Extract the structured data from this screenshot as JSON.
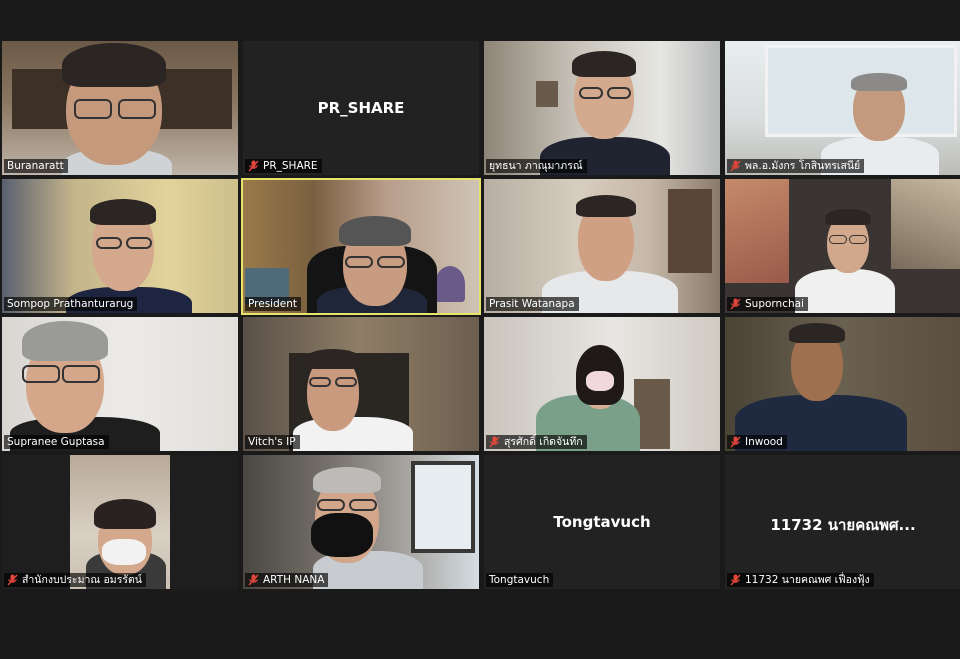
{
  "participants": [
    {
      "name": "Buranaratt",
      "muted": false
    },
    {
      "name": "PR_SHARE",
      "muted": true,
      "video_off": true,
      "display_name": "PR_SHARE"
    },
    {
      "name": "ยุทธนา ภาณุมาภรณ์",
      "muted": false
    },
    {
      "name": "พล.อ.มังกร โกสินทรเสนีย์",
      "muted": true
    },
    {
      "name": "Sompop Prathanturarug",
      "muted": false
    },
    {
      "name": "President",
      "muted": false,
      "active_speaker": true
    },
    {
      "name": "Prasit Watanapa",
      "muted": false
    },
    {
      "name": "Supornchai",
      "muted": true
    },
    {
      "name": "Supranee Guptasa",
      "muted": false
    },
    {
      "name": "Vitch's IP",
      "muted": false
    },
    {
      "name": "สุรศักดิ์ เกิดจันทึก",
      "muted": true
    },
    {
      "name": "Inwood",
      "muted": true
    },
    {
      "name": "สำนักงบประมาณ อมรรัตน์",
      "muted": true
    },
    {
      "name": "ARTH NANA",
      "muted": true
    },
    {
      "name": "Tongtavuch",
      "muted": false,
      "video_off": true,
      "display_name": "Tongtavuch"
    },
    {
      "name": "11732 นายคณพศ เฟื่องฟุ้ง",
      "muted": true,
      "video_off": true,
      "display_name": "11732 นายคณพศ..."
    }
  ],
  "colors": {
    "background": "#1a1a1a",
    "tile_off": "#222222",
    "active_border": "#e8e36a",
    "mute_icon": "#e0463b"
  },
  "icons": {
    "mute": "microphone-muted-icon"
  }
}
